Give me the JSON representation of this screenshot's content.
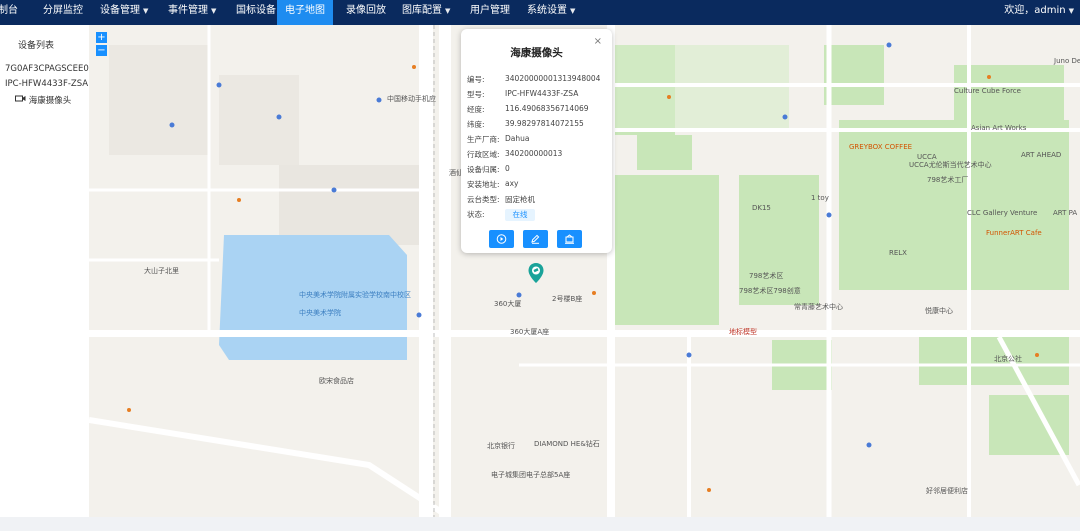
{
  "nav": {
    "items": [
      {
        "label": "制台"
      },
      {
        "label": "分屏监控"
      },
      {
        "label": "设备管理",
        "dropdown": true
      },
      {
        "label": "事件管理",
        "dropdown": true
      },
      {
        "label": "国标设备"
      },
      {
        "label": "电子地图",
        "active": true
      },
      {
        "label": "录像回放"
      },
      {
        "label": "图库配置",
        "dropdown": true
      },
      {
        "label": "用户管理"
      },
      {
        "label": "系统设置",
        "dropdown": true
      }
    ],
    "welcome": "欢迎，admin",
    "caret_icon": "chevron-down-icon"
  },
  "sidebar": {
    "title": "设备列表",
    "tree": [
      {
        "label": "7G0AF3CPAGSCEE0"
      },
      {
        "label": "IPC-HFW4433F-ZSA"
      },
      {
        "label": "海康摄像头",
        "icon": "camera-icon"
      }
    ]
  },
  "map": {
    "zoom_in": "+",
    "zoom_out": "−",
    "labels": [
      {
        "text": "大山子北里"
      },
      {
        "text": "中国移动手机应"
      },
      {
        "text": "中央美术学院附属实验学校南中校区"
      },
      {
        "text": "360大厦"
      },
      {
        "text": "360大厦A座"
      },
      {
        "text": "2号楼B座"
      },
      {
        "text": "DIAMOND HE&钻石"
      },
      {
        "text": "北京银行"
      },
      {
        "text": "电子城集团电子总部5A座"
      },
      {
        "text": "酒仙桥路"
      },
      {
        "text": "欧宋食品店"
      },
      {
        "text": "中央美术学院"
      },
      {
        "text": "DK15"
      },
      {
        "text": "798艺术区798创意"
      },
      {
        "text": "地标模型"
      },
      {
        "text": "UCCA尤伦斯当代艺术中心"
      },
      {
        "text": "Culture Cube Force"
      },
      {
        "text": "Asian Art Works"
      },
      {
        "text": "ART AHEAD"
      },
      {
        "text": "798艺术工厂"
      },
      {
        "text": "CLC Gallery Venture"
      },
      {
        "text": "ART PA"
      },
      {
        "text": "FunnerART Cafe"
      },
      {
        "text": "RELX"
      },
      {
        "text": "798艺术区"
      },
      {
        "text": "常青藤艺术中心"
      },
      {
        "text": "北京公社"
      },
      {
        "text": "GREYBOX COFFEE"
      },
      {
        "text": "UCCA"
      },
      {
        "text": "1 toy"
      },
      {
        "text": "Juno Design"
      },
      {
        "text": "悦康中心"
      },
      {
        "text": "好邻居便利店"
      }
    ]
  },
  "popup": {
    "title": "海康摄像头",
    "close": "×",
    "fields": [
      {
        "label": "编号:",
        "value": "34020000001313948004"
      },
      {
        "label": "型号:",
        "value": "IPC-HFW4433F-ZSA"
      },
      {
        "label": "经度:",
        "value": "116.49068356714069"
      },
      {
        "label": "纬度:",
        "value": "39.98297814072155"
      },
      {
        "label": "生产厂商:",
        "value": "Dahua"
      },
      {
        "label": "行政区域:",
        "value": "340200000013"
      },
      {
        "label": "设备归属:",
        "value": "0"
      },
      {
        "label": "安装地址:",
        "value": "axy"
      },
      {
        "label": "云台类型:",
        "value": "固定枪机"
      }
    ],
    "status_label": "状态:",
    "status_value": "在线",
    "buttons": [
      {
        "icon": "play-icon"
      },
      {
        "icon": "edit-icon"
      },
      {
        "icon": "record-icon"
      }
    ]
  },
  "colors": {
    "topbar": "#0a2a5e",
    "active_tab": "#1e8cf0",
    "accent": "#1890ff",
    "map_bg": "#f3f1ec",
    "park": "#c8e6b8",
    "water": "#aad3f3",
    "pin": "#1aa39a"
  }
}
